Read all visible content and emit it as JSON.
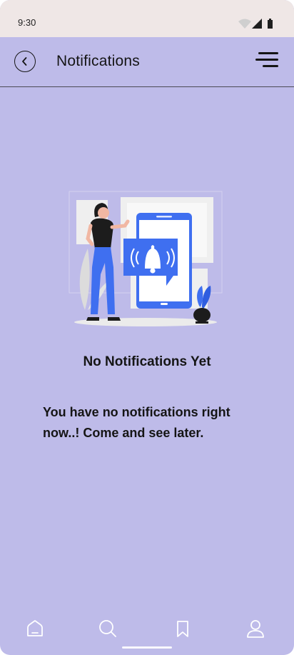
{
  "status_bar": {
    "time": "9:30"
  },
  "header": {
    "title": "Notifications",
    "back_icon": "chevron-left-icon",
    "menu_icon": "hamburger-menu-icon"
  },
  "empty_state": {
    "title": "No Notifications Yet",
    "message": "You have no notifications right now..! Come and see later.",
    "illustration": "person-with-phone-bell-illustration"
  },
  "bottom_nav": {
    "items": [
      {
        "icon": "home-icon"
      },
      {
        "icon": "search-icon"
      },
      {
        "icon": "bookmark-icon"
      },
      {
        "icon": "profile-icon"
      }
    ]
  },
  "colors": {
    "background": "#bebbe9",
    "status_bar": "#efe7e6",
    "accent": "#3f6ff0",
    "text": "#151515"
  }
}
